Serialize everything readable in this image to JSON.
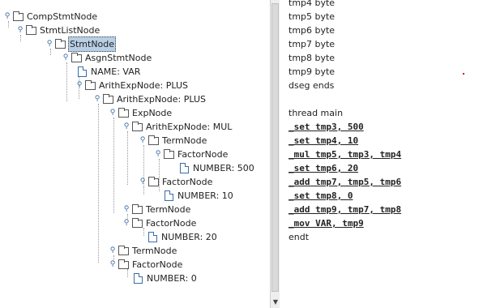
{
  "tree": {
    "nodes": [
      {
        "label": "CompStmtNode",
        "kind": "folder",
        "expanded": true
      },
      {
        "label": "StmtListNode",
        "kind": "folder",
        "expanded": true
      },
      {
        "label": "StmtNode",
        "kind": "folder",
        "expanded": true,
        "selected": true
      },
      {
        "label": "AsgnStmtNode",
        "kind": "folder",
        "expanded": true
      },
      {
        "label": "NAME: VAR",
        "kind": "leaf"
      },
      {
        "label": "ArithExpNode: PLUS",
        "kind": "folder",
        "expanded": true
      },
      {
        "label": "ArithExpNode: PLUS",
        "kind": "folder",
        "expanded": true
      },
      {
        "label": "ExpNode",
        "kind": "folder",
        "expanded": true
      },
      {
        "label": "ArithExpNode: MUL",
        "kind": "folder",
        "expanded": true
      },
      {
        "label": "TermNode",
        "kind": "folder",
        "expanded": true
      },
      {
        "label": "FactorNode",
        "kind": "folder",
        "expanded": true
      },
      {
        "label": "NUMBER: 500",
        "kind": "leaf"
      },
      {
        "label": "FactorNode",
        "kind": "folder",
        "expanded": true
      },
      {
        "label": "NUMBER: 10",
        "kind": "leaf"
      },
      {
        "label": "TermNode",
        "kind": "folder",
        "expanded": true
      },
      {
        "label": "FactorNode",
        "kind": "folder",
        "expanded": true
      },
      {
        "label": "NUMBER: 20",
        "kind": "leaf"
      },
      {
        "label": "TermNode",
        "kind": "folder",
        "expanded": true
      },
      {
        "label": "FactorNode",
        "kind": "folder",
        "expanded": true
      },
      {
        "label": "NUMBER: 0",
        "kind": "leaf"
      }
    ]
  },
  "code": {
    "lines": [
      {
        "text": "tmp4 byte",
        "style": "plain"
      },
      {
        "text": "tmp5 byte",
        "style": "plain"
      },
      {
        "text": "tmp6 byte",
        "style": "plain"
      },
      {
        "text": "tmp7 byte",
        "style": "plain"
      },
      {
        "text": "tmp8 byte",
        "style": "plain"
      },
      {
        "text": "tmp9 byte",
        "style": "plain"
      },
      {
        "text": "dseg ends",
        "style": "plain"
      },
      {
        "text": "",
        "style": "plain"
      },
      {
        "text": "thread main",
        "style": "plain"
      },
      {
        "text": "_set tmp3, 500",
        "style": "asm"
      },
      {
        "text": "_set tmp4, 10",
        "style": "asm"
      },
      {
        "text": "_mul tmp5, tmp3, tmp4",
        "style": "asm"
      },
      {
        "text": "_set tmp6, 20",
        "style": "asm"
      },
      {
        "text": "_add tmp7, tmp5, tmp6",
        "style": "asm"
      },
      {
        "text": "_set tmp8, 0",
        "style": "asm"
      },
      {
        "text": "_add tmp9, tmp7, tmp8",
        "style": "asm"
      },
      {
        "text": "_mov VAR, tmp9",
        "style": "asm"
      },
      {
        "text": "endt",
        "style": "plain"
      }
    ]
  },
  "colors": {
    "selection": "#b8cfe5",
    "handle": "#3a6ea5",
    "accent_dot": "#dd0000"
  }
}
